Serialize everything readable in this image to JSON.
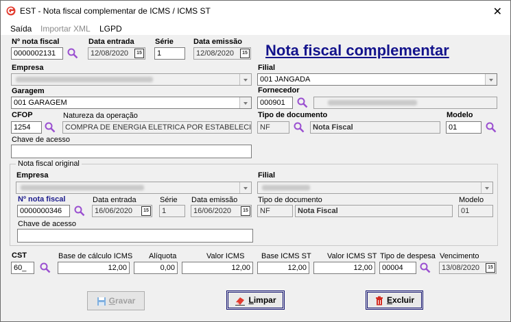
{
  "window": {
    "title": "EST - Nota fiscal complementar de ICMS / ICMS ST",
    "close_glyph": "✕"
  },
  "menu": [
    "Saída",
    "Importar XML",
    "LGPD"
  ],
  "header_title": "Nota fiscal complementar",
  "fields": {
    "nota_fiscal": {
      "label": "Nº nota fiscal",
      "value": "0000002131"
    },
    "data_entrada": {
      "label": "Data entrada",
      "value": "12/08/2020"
    },
    "serie": {
      "label": "Série",
      "value": "1"
    },
    "data_emissao": {
      "label": "Data emissão",
      "value": "12/08/2020"
    },
    "empresa": {
      "label": "Empresa",
      "value": ""
    },
    "filial": {
      "label": "Filial",
      "value": "001 JANGADA"
    },
    "garagem": {
      "label": "Garagem",
      "value": "001 GARAGEM"
    },
    "fornecedor": {
      "label": "Fornecedor",
      "code": "000901",
      "name": ""
    },
    "cfop": {
      "label": "CFOP",
      "value": "1254"
    },
    "natureza": {
      "label": "Natureza da operação",
      "value": "COMPRA DE ENERGIA ELETRICA POR ESTABELECIM"
    },
    "tipo_documento": {
      "label": "Tipo de documento",
      "code": "NF",
      "name": "Nota Fiscal"
    },
    "modelo": {
      "label": "Modelo",
      "value": "01"
    },
    "chave_acesso": {
      "label": "Chave de acesso",
      "value": ""
    }
  },
  "original": {
    "group_title": "Nota fiscal original",
    "empresa": {
      "label": "Empresa",
      "value": ""
    },
    "filial": {
      "label": "Filial",
      "value": ""
    },
    "nota_fiscal": {
      "label": "Nº nota fiscal",
      "value": "0000000346"
    },
    "data_entrada": {
      "label": "Data entrada",
      "value": "16/06/2020"
    },
    "serie": {
      "label": "Série",
      "value": "1"
    },
    "data_emissao": {
      "label": "Data emissão",
      "value": "16/06/2020"
    },
    "tipo_documento": {
      "label": "Tipo de documento",
      "code": "NF",
      "name": "Nota Fiscal"
    },
    "modelo": {
      "label": "Modelo",
      "value": "01"
    },
    "chave_acesso": {
      "label": "Chave de acesso",
      "value": ""
    }
  },
  "bottom": {
    "cst": {
      "label": "CST",
      "value": "60_"
    },
    "base_icms": {
      "label": "Base de cálculo ICMS",
      "value": "12,00"
    },
    "aliquota": {
      "label": "Alíquota",
      "value": "0,00"
    },
    "valor_icms": {
      "label": "Valor ICMS",
      "value": "12,00"
    },
    "base_icms_st": {
      "label": "Base ICMS ST",
      "value": "12,00"
    },
    "valor_icms_st": {
      "label": "Valor ICMS ST",
      "value": "12,00"
    },
    "tipo_despesa": {
      "label": "Tipo de despesa",
      "value": "00004"
    },
    "vencimento": {
      "label": "Vencimento",
      "value": "13/08/2020"
    }
  },
  "buttons": {
    "gravar_first": "G",
    "gravar_rest": "ravar",
    "limpar_first": "L",
    "limpar_rest": "impar",
    "excluir_first": "E",
    "excluir_rest": "xcluir"
  },
  "calendar_icon_text": "15",
  "colors": {
    "title_blue": "#13138c",
    "search_icon": "#9a4fd0"
  }
}
